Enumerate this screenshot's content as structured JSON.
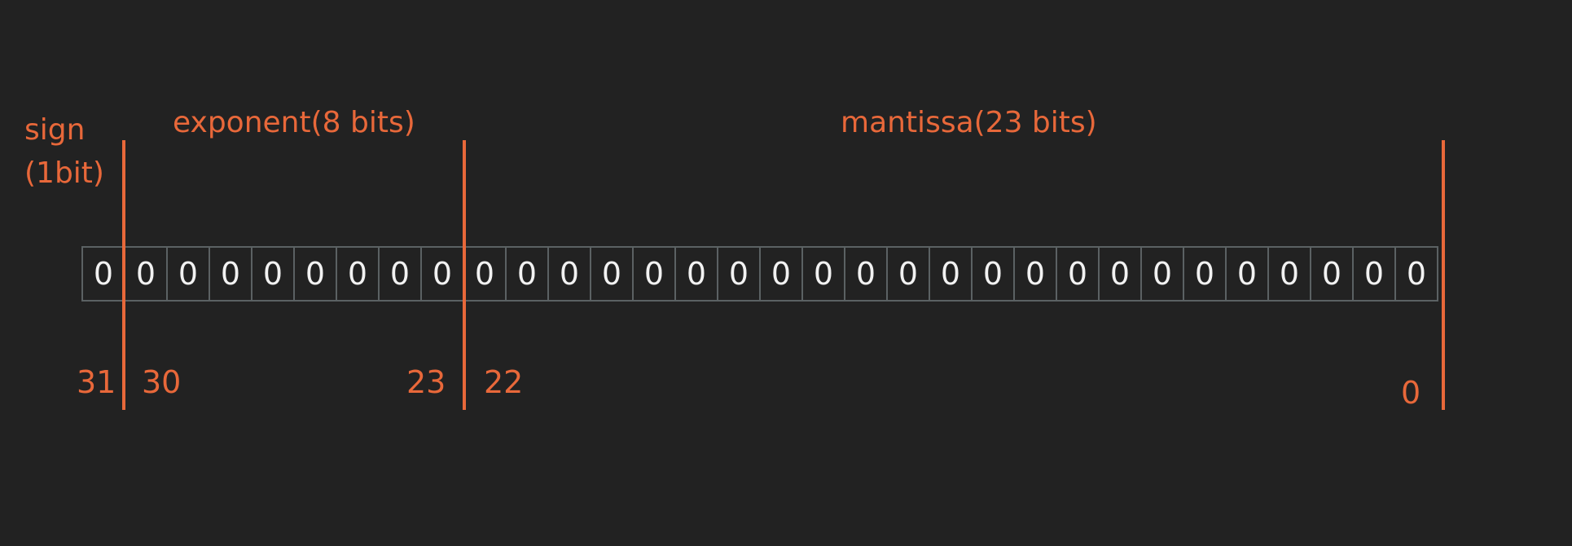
{
  "labels": {
    "sign_line1": "sign",
    "sign_line2": "(1bit)",
    "exponent": "exponent(8 bits)",
    "mantissa": "mantissa(23 bits)"
  },
  "bits": [
    "0",
    "0",
    "0",
    "0",
    "0",
    "0",
    "0",
    "0",
    "0",
    "0",
    "0",
    "0",
    "0",
    "0",
    "0",
    "0",
    "0",
    "0",
    "0",
    "0",
    "0",
    "0",
    "0",
    "0",
    "0",
    "0",
    "0",
    "0",
    "0",
    "0",
    "0",
    "0"
  ],
  "indices": {
    "i31": "31",
    "i30": "30",
    "i23": "23",
    "i22": "22",
    "i0": "0"
  },
  "colors": {
    "accent": "#e8683a",
    "background": "#222222",
    "cell_border": "#5b6163",
    "bit_text": "#f2f2f2"
  }
}
